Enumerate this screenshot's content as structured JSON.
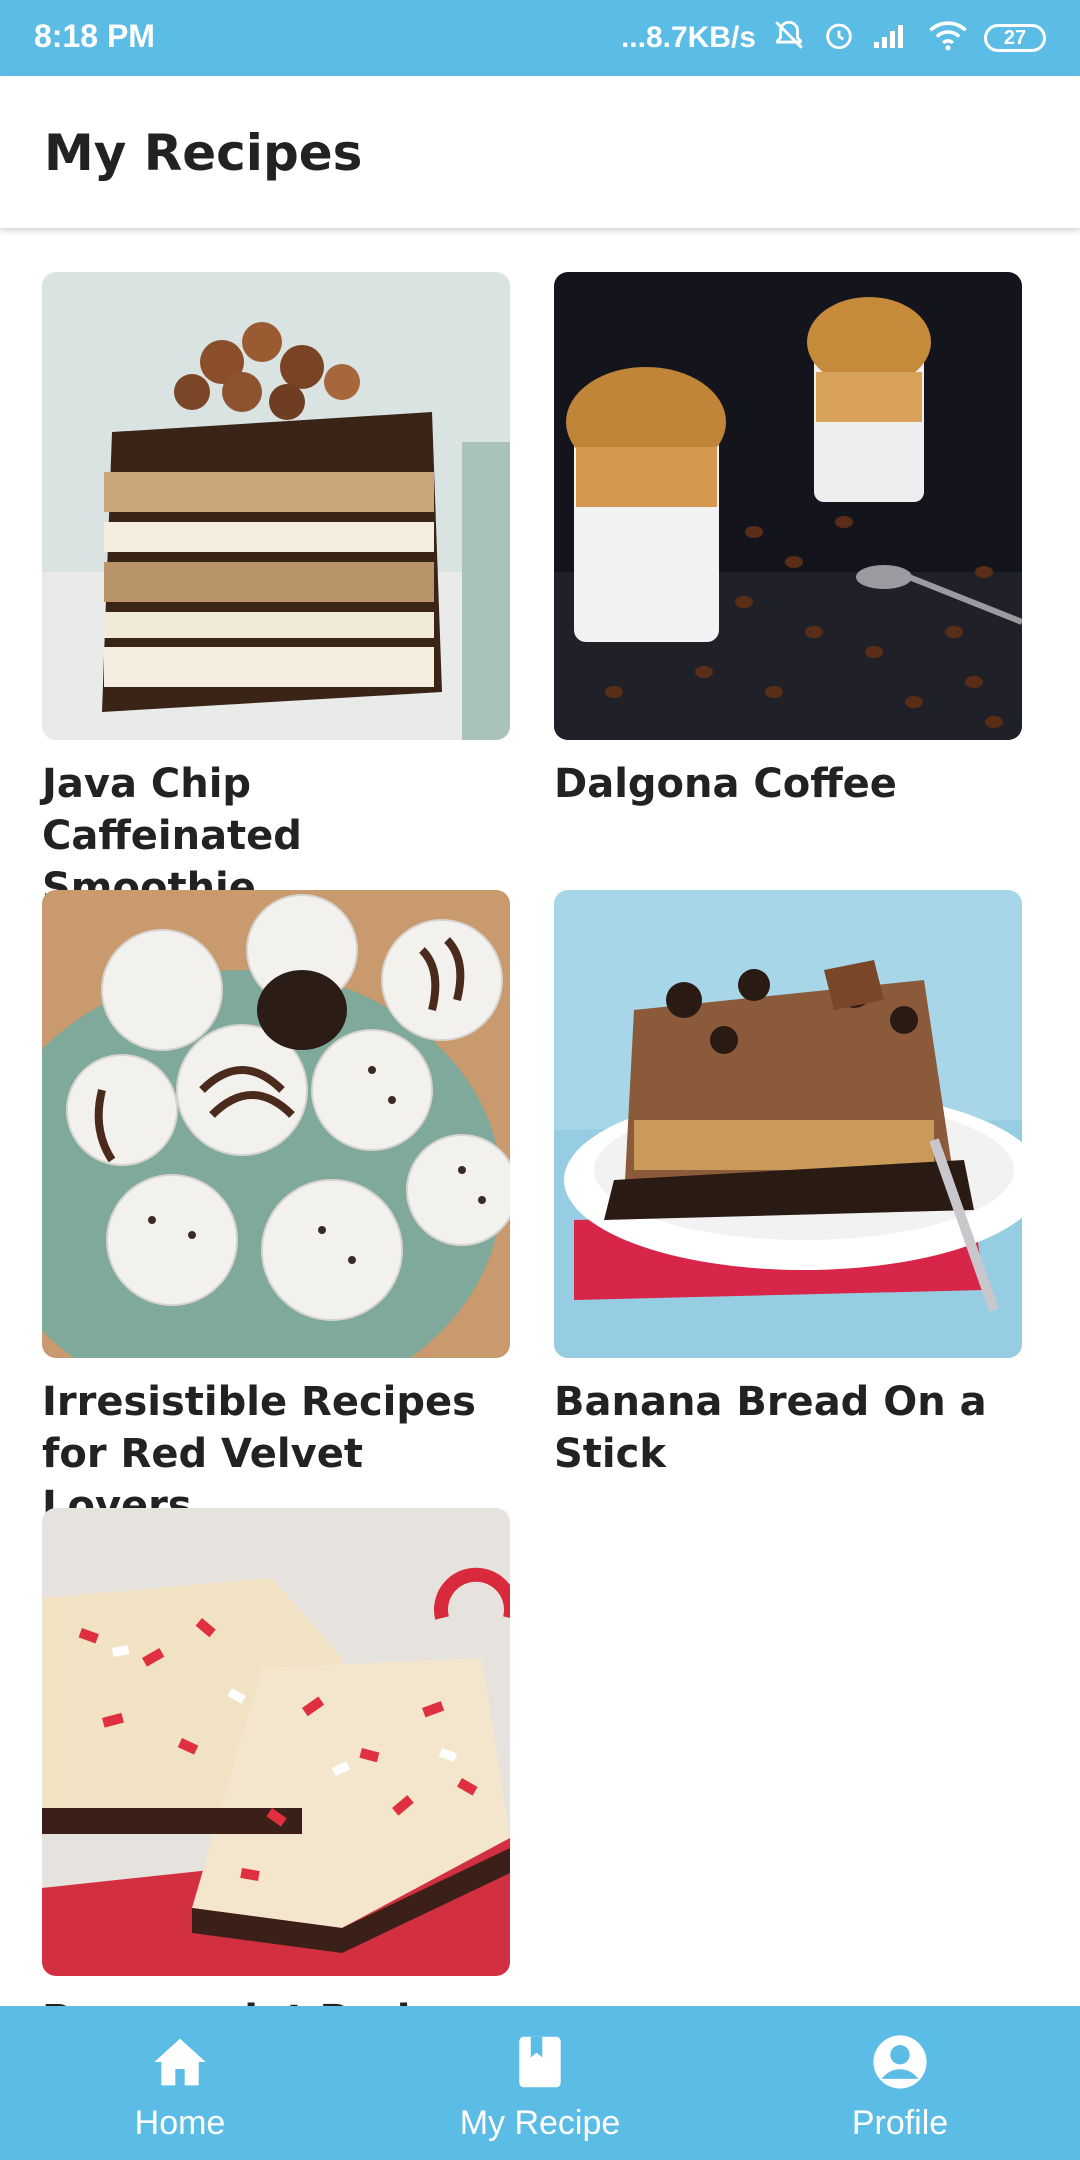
{
  "status_bar": {
    "time": "8:18 PM",
    "network_speed": "...8.7KB/s",
    "battery": "27"
  },
  "header": {
    "title": "My Recipes"
  },
  "recipes": [
    {
      "title": "Java Chip Caffeinated Smoothie",
      "image_icon": "layered-ice-cream-cake-image"
    },
    {
      "title": "Dalgona Coffee",
      "image_icon": "whipped-coffee-glasses-image"
    },
    {
      "title": "Irresistible Recipes for Red Velvet Lovers",
      "image_icon": "white-chocolate-truffles-image"
    },
    {
      "title": "Banana Bread On a Stick",
      "image_icon": "chocolate-pie-slice-image"
    },
    {
      "title": "Peppermint Bark",
      "image_icon": "peppermint-bark-image"
    }
  ],
  "bottom_nav": {
    "items": [
      {
        "label": "Home",
        "icon": "home-icon"
      },
      {
        "label": "My Recipe",
        "icon": "book-icon"
      },
      {
        "label": "Profile",
        "icon": "account-circle-icon"
      }
    ]
  },
  "colors": {
    "accent": "#5bbde6",
    "text": "#222222",
    "background": "#ffffff"
  }
}
